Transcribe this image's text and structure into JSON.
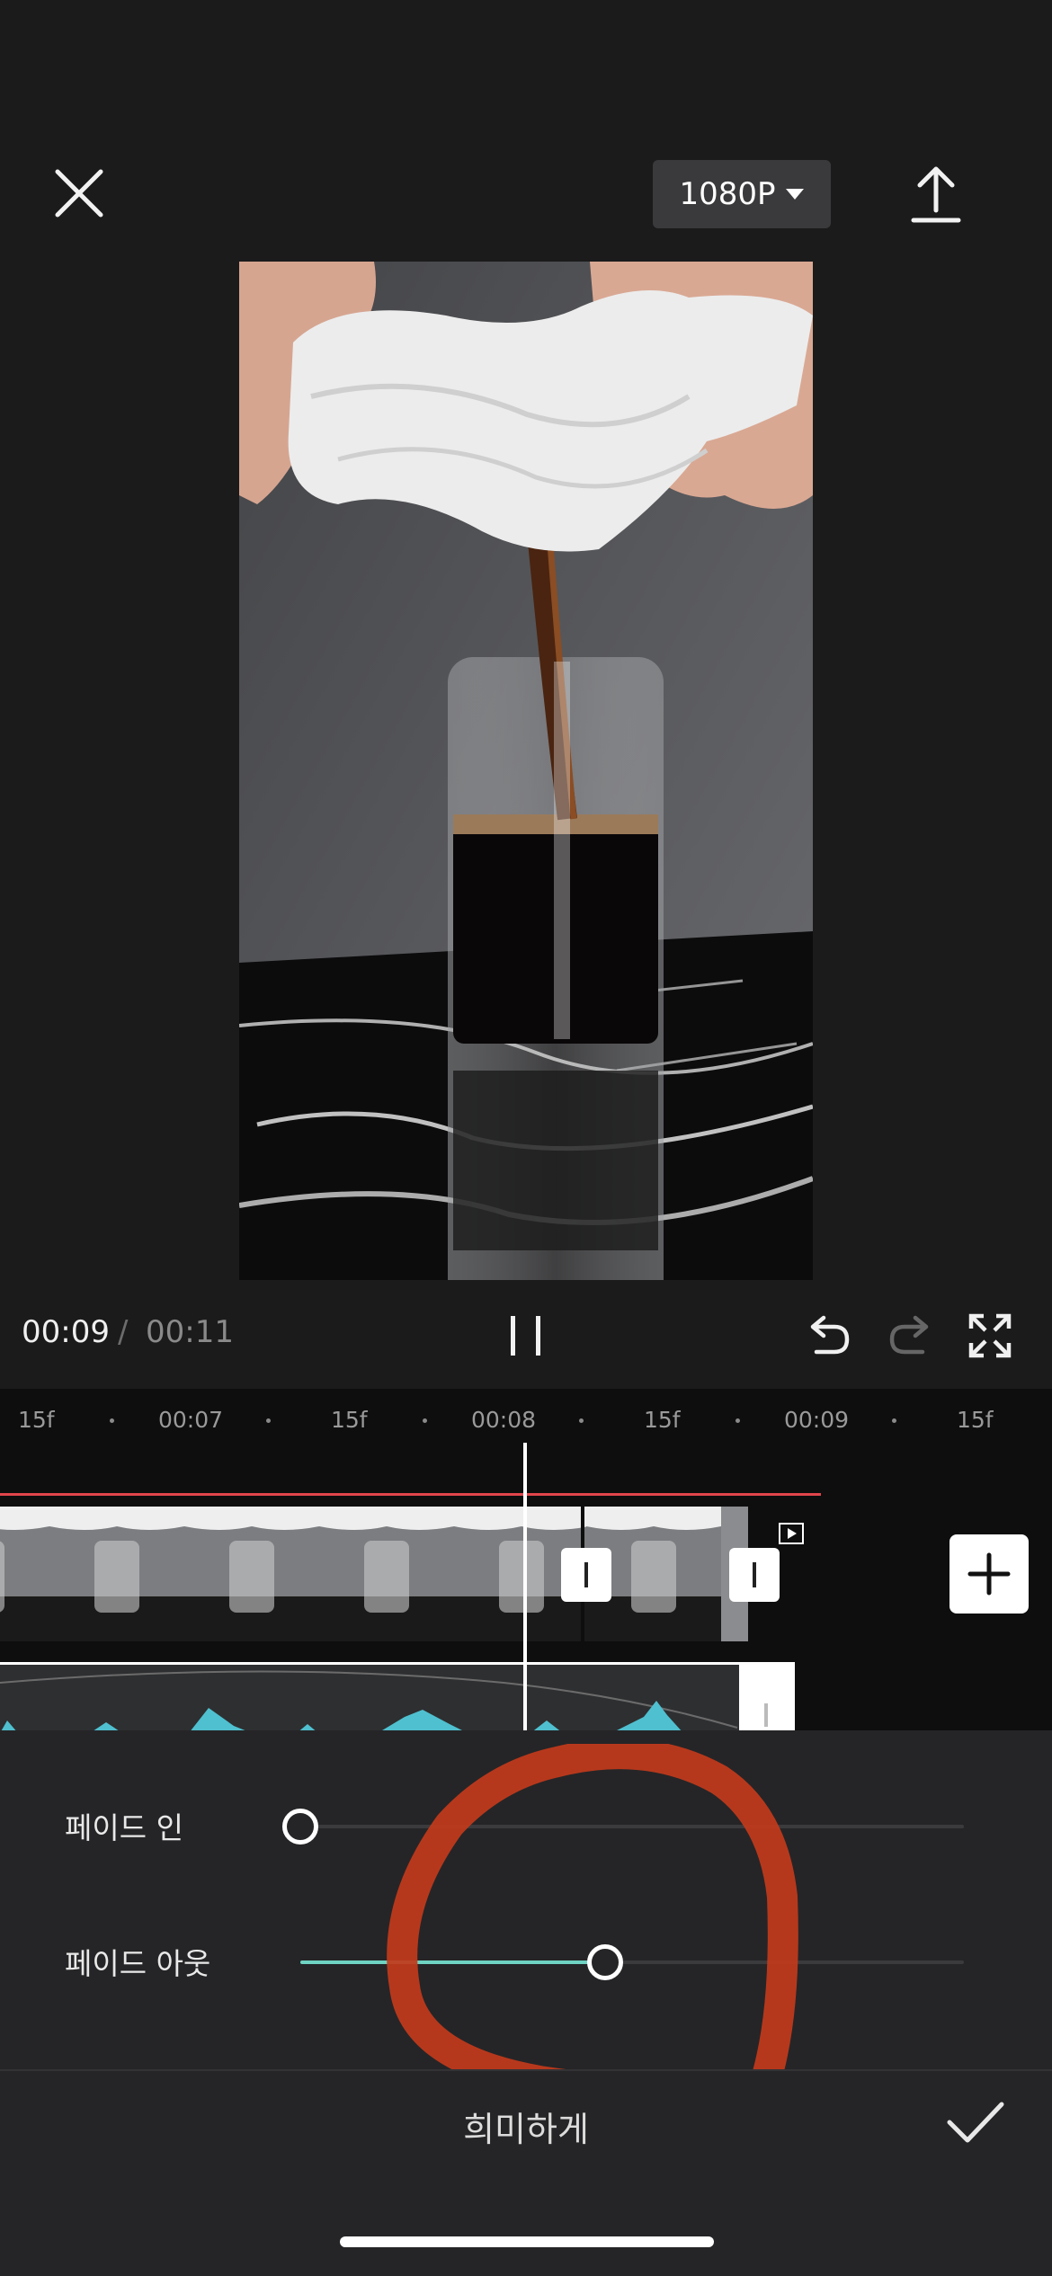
{
  "top_bar": {
    "quality_label": "1080P"
  },
  "playback": {
    "current_time": "00:09",
    "separator": "/",
    "total_time": "00:11"
  },
  "ruler": {
    "labels": [
      "15f",
      "00:07",
      "15f",
      "00:08",
      "15f",
      "00:09",
      "15f"
    ]
  },
  "fade_panel": {
    "fade_in_label": "페이드 인",
    "fade_in_value": 0.0,
    "fade_out_label": "페이드 아웃",
    "fade_out_value": 0.46,
    "title": "희미하게"
  },
  "colors": {
    "accent": "#6fd3c3",
    "playhead_marker": "#e0454b",
    "annotation": "#c23a1c"
  }
}
